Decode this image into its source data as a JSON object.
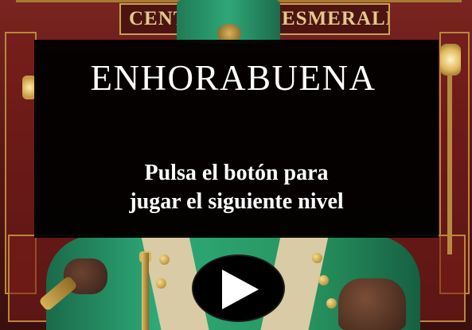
{
  "background": {
    "sign_left_text": "CENT",
    "sign_right_text": "ESMERALDA"
  },
  "dialog": {
    "title": "ENHORABUENA",
    "message_line1": "Pulsa el botón para",
    "message_line2": "jugar el siguiente nivel"
  },
  "play_button": {
    "icon": "play-icon"
  },
  "colors": {
    "dialog_bg": "#000000",
    "text": "#ffffff",
    "coat_green": "#2eaa78",
    "wall_red": "#5b1716",
    "gold_trim": "#c9a24e"
  }
}
